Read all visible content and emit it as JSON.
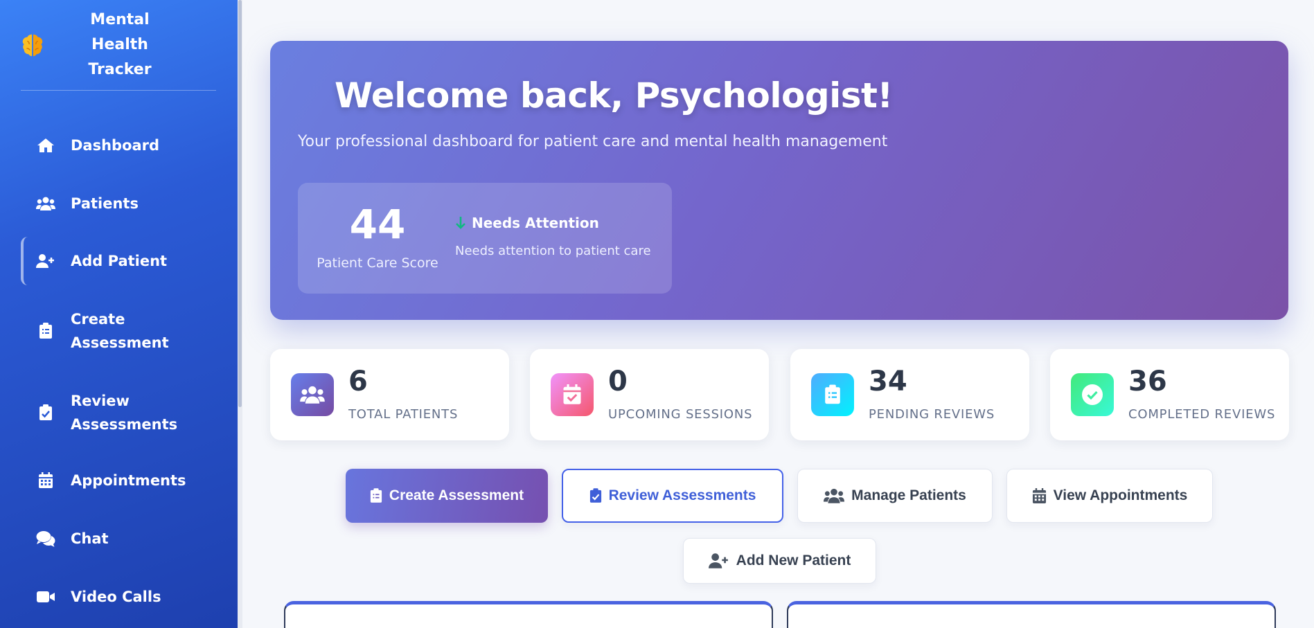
{
  "app": {
    "title": "Mental Health Tracker",
    "logo_icon": "brain-icon"
  },
  "sidebar": {
    "items": [
      {
        "label": "Dashboard",
        "icon": "home-icon"
      },
      {
        "label": "Patients",
        "icon": "users-icon"
      },
      {
        "label": "Add Patient",
        "icon": "user-plus-icon"
      },
      {
        "label": "Create Assessment",
        "icon": "clipboard-list-icon"
      },
      {
        "label": "Review Assessments",
        "icon": "clipboard-check-icon"
      },
      {
        "label": "Appointments",
        "icon": "calendar-icon"
      },
      {
        "label": "Chat",
        "icon": "comments-icon"
      },
      {
        "label": "Video Calls",
        "icon": "video-icon"
      }
    ]
  },
  "hero": {
    "title": "Welcome back, Psychologist!",
    "subtitle": "Your professional dashboard for patient care and mental health management",
    "score": {
      "value": "44",
      "label": "Patient Care Score"
    },
    "attention": {
      "title": "Needs Attention",
      "text": "Needs attention to patient care"
    }
  },
  "stats": [
    {
      "value": "6",
      "label": "TOTAL PATIENTS",
      "icon": "users-icon"
    },
    {
      "value": "0",
      "label": "UPCOMING SESSIONS",
      "icon": "calendar-check-icon"
    },
    {
      "value": "34",
      "label": "PENDING REVIEWS",
      "icon": "clipboard-list-icon"
    },
    {
      "value": "36",
      "label": "COMPLETED REVIEWS",
      "icon": "check-circle-icon"
    }
  ],
  "actions": {
    "create_assessment": "Create Assessment",
    "review_assessments": "Review Assessments",
    "manage_patients": "Manage Patients",
    "view_appointments": "View Appointments",
    "add_new_patient": "Add New Patient"
  },
  "colors": {
    "sidebar": "#2b5bd6",
    "hero_start": "#6a7fe0",
    "hero_end": "#7b52a8",
    "accent": "#4461e8",
    "attention_arrow": "#10b981"
  }
}
